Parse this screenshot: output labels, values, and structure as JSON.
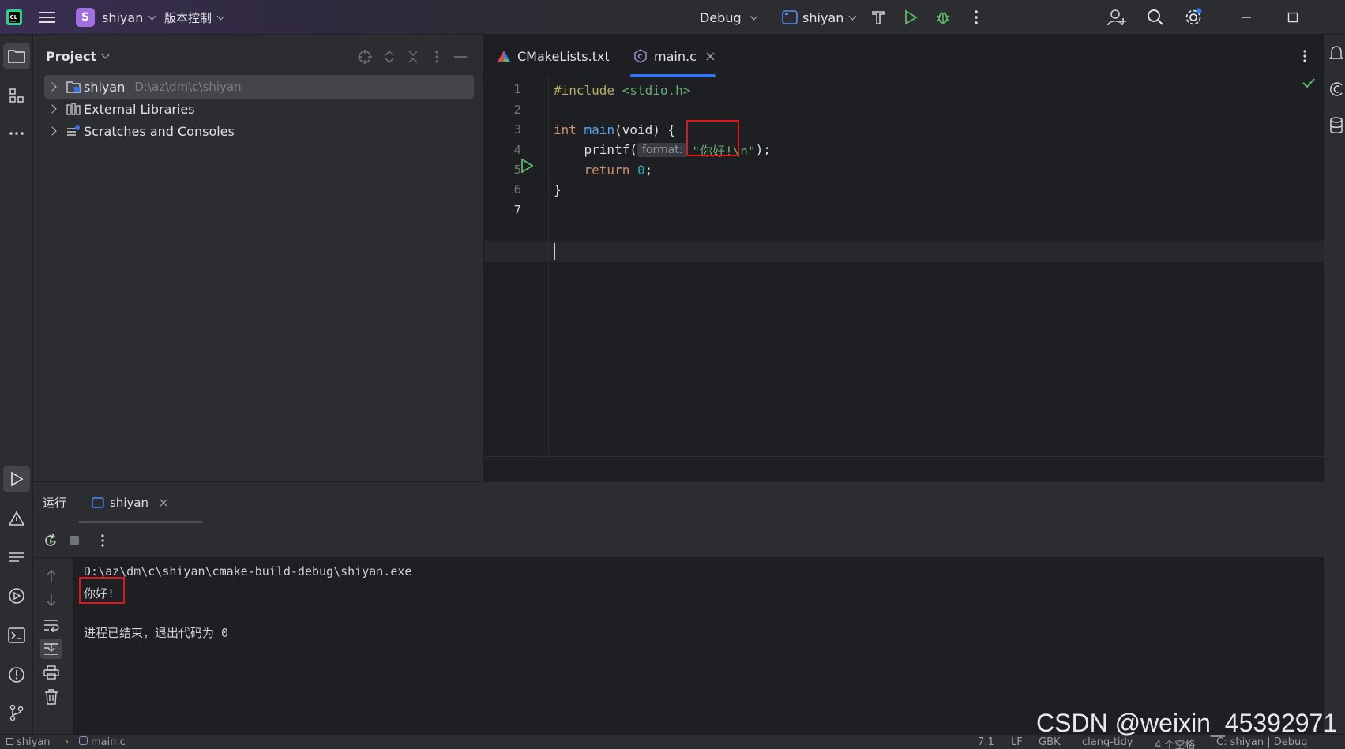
{
  "titlebar": {
    "project_initial": "S",
    "project_name": "shiyan",
    "vcs_menu": "版本控制",
    "run_config": "Debug",
    "target_name": "shiyan",
    "accent": "#a56ee0"
  },
  "project_panel": {
    "title": "Project",
    "tree": [
      {
        "label": "shiyan",
        "hint": "D:\\az\\dm\\c\\shiyan"
      },
      {
        "label": "External Libraries",
        "hint": ""
      },
      {
        "label": "Scratches and Consoles",
        "hint": ""
      }
    ]
  },
  "editor": {
    "tabs": [
      {
        "label": "CMakeLists.txt"
      },
      {
        "label": "main.c"
      }
    ],
    "line_numbers": [
      "1",
      "2",
      "3",
      "4",
      "5",
      "6",
      "7"
    ],
    "code": {
      "l1_directive": "#include",
      "l1_header": " <stdio.h>",
      "l3_type": "int",
      "l3_func": " main",
      "l3_rest": "(void) {",
      "l4_indent": "    ",
      "l4_call": "printf(",
      "l4_hint": "format:",
      "l4_string": "\"你好!\\n\"",
      "l4_end": ");",
      "l5_indent": "    ",
      "l5_kw": "return",
      "l5_num": " 0",
      "l5_end": ";",
      "l6": "}"
    }
  },
  "run_panel": {
    "title": "运行",
    "tab_label": "shiyan",
    "console": {
      "exe_path": "D:\\az\\dm\\c\\shiyan\\cmake-build-debug\\shiyan.exe",
      "output": "你好!",
      "exit_message": "进程已结束，退出代码为 0"
    }
  },
  "statusbar": {
    "breadcrumb_project": "shiyan",
    "breadcrumb_file": "main.c",
    "cursor_pos": "7:1",
    "line_sep": "LF",
    "encoding": "GBK",
    "inspector": "clang-tidy",
    "indent": "4 个空格",
    "context": "C: shiyan | Debug"
  },
  "watermark": "CSDN @weixin_45392971"
}
